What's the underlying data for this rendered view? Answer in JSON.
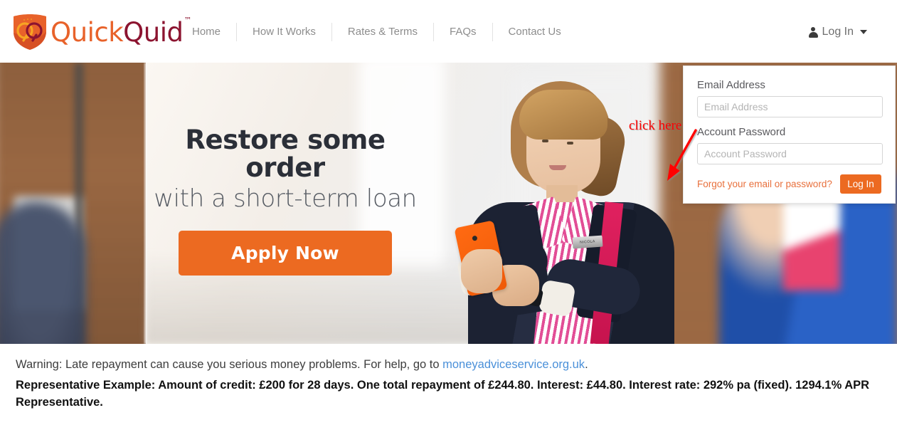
{
  "brand": {
    "name_first": "Quick",
    "name_second": "Quid",
    "trademark": "™",
    "shield_color": "#E8622A",
    "quick_color": "#E8622A",
    "quid_color": "#8C1430"
  },
  "nav": {
    "items": [
      {
        "label": "Home"
      },
      {
        "label": "How It Works"
      },
      {
        "label": "Rates & Terms"
      },
      {
        "label": "FAQs"
      },
      {
        "label": "Contact Us"
      }
    ]
  },
  "account": {
    "toggle_label": "Log In",
    "icon": "person-icon",
    "caret": "chevron-down-icon"
  },
  "login_panel": {
    "email_label": "Email Address",
    "email_placeholder": "Email Address",
    "email_value": "",
    "password_label": "Account Password",
    "password_placeholder": "Account Password",
    "password_value": "",
    "forgot_label": "Forgot your email or password?",
    "submit_label": "Log In",
    "submit_color": "#EC6A21",
    "forgot_color": "#E8703C"
  },
  "annotation": {
    "text": "click here",
    "color": "#FF0000",
    "arrow": "red-arrow-down-right"
  },
  "hero": {
    "headline": "Restore some order",
    "subheadline": "with a short-term loan",
    "cta_label": "Apply Now",
    "cta_color": "#EC6A21",
    "badge_text": "NICOLA"
  },
  "footer": {
    "warning_prefix": "Warning: Late repayment can cause you serious money problems. For help, go to ",
    "warning_link": "moneyadviceservice.org.uk",
    "warning_suffix": ".",
    "warning_link_color": "#4A90D9",
    "representative_example": "Representative Example: Amount of credit: £200 for 28 days. One total repayment of £244.80. Interest: £44.80. Interest rate: 292% pa (fixed). 1294.1% APR Representative."
  }
}
